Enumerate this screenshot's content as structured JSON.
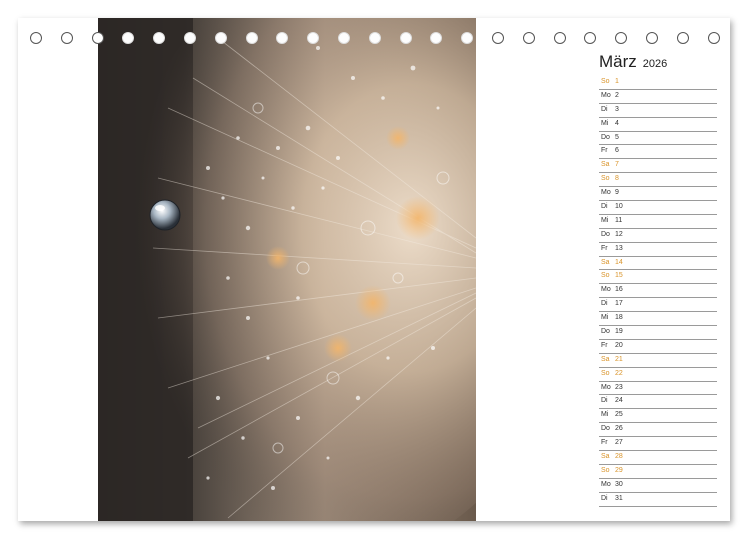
{
  "calendar": {
    "month": "März",
    "year": "2026",
    "days": [
      {
        "wd": "So",
        "num": "1",
        "weekend": true
      },
      {
        "wd": "Mo",
        "num": "2",
        "weekend": false
      },
      {
        "wd": "Di",
        "num": "3",
        "weekend": false
      },
      {
        "wd": "Mi",
        "num": "4",
        "weekend": false
      },
      {
        "wd": "Do",
        "num": "5",
        "weekend": false
      },
      {
        "wd": "Fr",
        "num": "6",
        "weekend": false
      },
      {
        "wd": "Sa",
        "num": "7",
        "weekend": true
      },
      {
        "wd": "So",
        "num": "8",
        "weekend": true
      },
      {
        "wd": "Mo",
        "num": "9",
        "weekend": false
      },
      {
        "wd": "Di",
        "num": "10",
        "weekend": false
      },
      {
        "wd": "Mi",
        "num": "11",
        "weekend": false
      },
      {
        "wd": "Do",
        "num": "12",
        "weekend": false
      },
      {
        "wd": "Fr",
        "num": "13",
        "weekend": false
      },
      {
        "wd": "Sa",
        "num": "14",
        "weekend": true
      },
      {
        "wd": "So",
        "num": "15",
        "weekend": true
      },
      {
        "wd": "Mo",
        "num": "16",
        "weekend": false
      },
      {
        "wd": "Di",
        "num": "17",
        "weekend": false
      },
      {
        "wd": "Mi",
        "num": "18",
        "weekend": false
      },
      {
        "wd": "Do",
        "num": "19",
        "weekend": false
      },
      {
        "wd": "Fr",
        "num": "20",
        "weekend": false
      },
      {
        "wd": "Sa",
        "num": "21",
        "weekend": true
      },
      {
        "wd": "So",
        "num": "22",
        "weekend": true
      },
      {
        "wd": "Mo",
        "num": "23",
        "weekend": false
      },
      {
        "wd": "Di",
        "num": "24",
        "weekend": false
      },
      {
        "wd": "Mi",
        "num": "25",
        "weekend": false
      },
      {
        "wd": "Do",
        "num": "26",
        "weekend": false
      },
      {
        "wd": "Fr",
        "num": "27",
        "weekend": false
      },
      {
        "wd": "Sa",
        "num": "28",
        "weekend": true
      },
      {
        "wd": "So",
        "num": "29",
        "weekend": true
      },
      {
        "wd": "Mo",
        "num": "30",
        "weekend": false
      },
      {
        "wd": "Di",
        "num": "31",
        "weekend": false
      }
    ]
  },
  "colors": {
    "weekend": "#d9942a",
    "weekday": "#333333",
    "rule_line": "#9a9a9a"
  },
  "photo": {
    "subject_icon": "dandelion-seedhead-with-droplets-image"
  },
  "binding": {
    "ring_count": 23,
    "ring_icon": "spiral-binding-ring-icon"
  }
}
